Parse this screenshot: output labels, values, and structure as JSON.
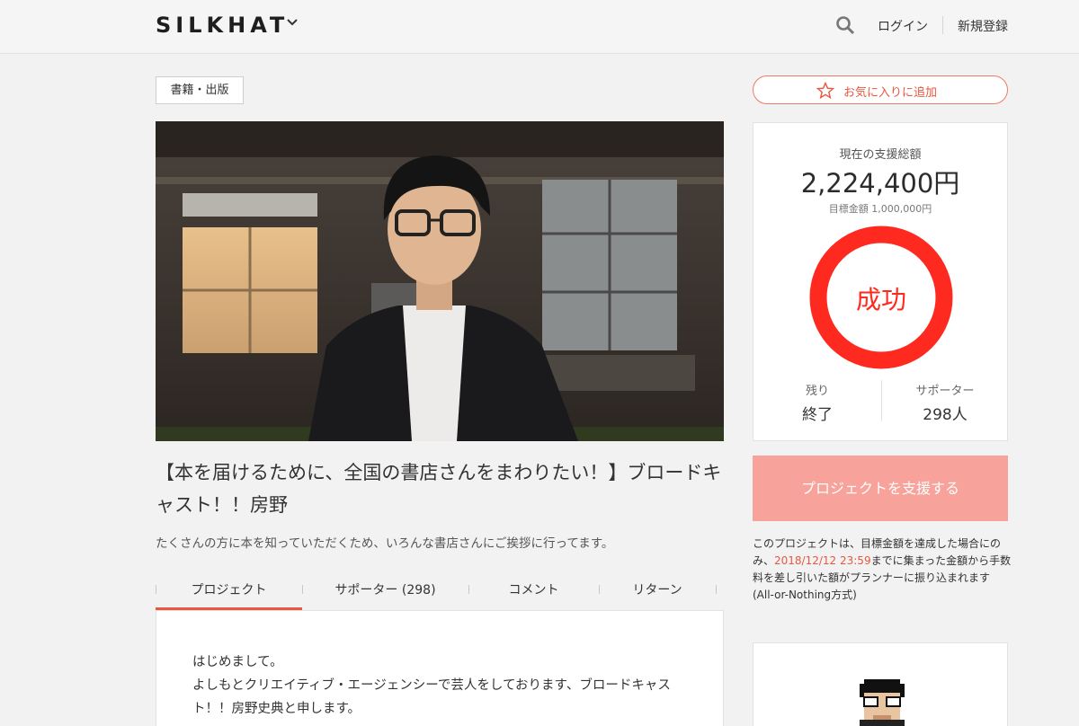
{
  "header": {
    "logo": "SILKHAT",
    "login": "ログイン",
    "signup": "新規登録"
  },
  "project": {
    "category": "書籍・出版",
    "title": "【本を届けるために、全国の書店さんをまわりたい！】ブロードキャスト！！房野",
    "subtitle": "たくさんの方に本を知っていただくため、いろんな書店さんにご挨拶に行ってます。"
  },
  "favorite": {
    "label": "お気に入りに追加"
  },
  "tabs": [
    {
      "label": "プロジェクト",
      "active": true
    },
    {
      "label": "サポーター (298)",
      "active": false
    },
    {
      "label": "コメント",
      "active": false
    },
    {
      "label": "リターン",
      "active": false
    }
  ],
  "content": {
    "line1": "はじめまして。",
    "line2": "よしもとクリエイティブ・エージェンシーで芸人をしております、ブロードキャスト！！房野史典と申します。"
  },
  "funding": {
    "total_label": "現在の支援総額",
    "total_amount": "2,224,400円",
    "goal": "目標金額 1,000,000円",
    "status": "成功",
    "remaining_label": "残り",
    "remaining_value": "終了",
    "supporters_label": "サポーター",
    "supporters_value": "298人",
    "ring_color": "#ff2a1f"
  },
  "support_button": {
    "label": "プロジェクトを支援する"
  },
  "note": {
    "before_date": "このプロジェクトは、目標金額を達成した場合にのみ、",
    "date": "2018/12/12 23:59",
    "after_date": "までに集まった金額から手数料を差し引いた額がプランナーに振り込まれます (All-or-Nothing方式)"
  },
  "colors": {
    "accent": "#e8573f",
    "button": "#f7a29a"
  }
}
